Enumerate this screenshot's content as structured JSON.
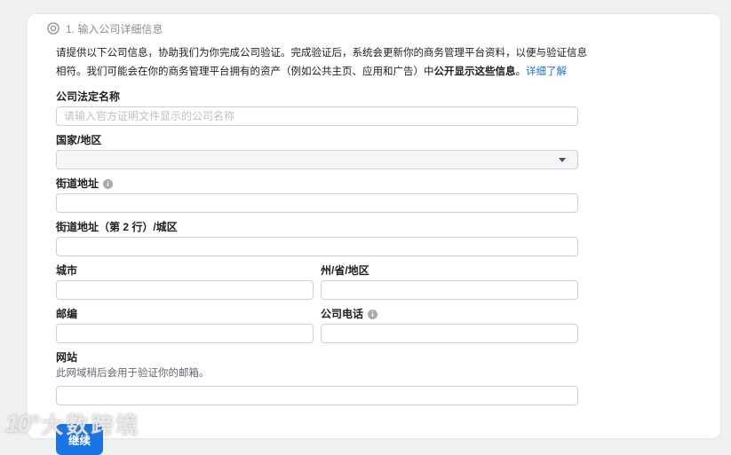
{
  "step": {
    "label": "1. 输入公司详细信息"
  },
  "intro": {
    "text": "请提供以下公司信息，协助我们为你完成公司验证。完成验证后，系统会更新你的商务管理平台资料，以便与验证信息相符。我们可能会在你的商务管理平台拥有的资产（例如公共主页、应用和广告）中",
    "bold": "公开显示这些信息",
    "period": "。",
    "link": "详细了解"
  },
  "fields": {
    "legal_name": {
      "label": "公司法定名称",
      "placeholder": "请输入官方证明文件显示的公司名称",
      "value": ""
    },
    "country": {
      "label": "国家/地区",
      "selected": ""
    },
    "street": {
      "label": "街道地址",
      "value": ""
    },
    "street2": {
      "label": "街道地址（第 2 行）/城区",
      "value": ""
    },
    "city": {
      "label": "城市",
      "value": ""
    },
    "state": {
      "label": "州/省/地区",
      "value": ""
    },
    "postal": {
      "label": "邮编",
      "value": ""
    },
    "phone": {
      "label": "公司电话",
      "value": ""
    },
    "website": {
      "label": "网站",
      "hint": "此网域稍后会用于验证你的邮箱。",
      "value": ""
    }
  },
  "actions": {
    "continue": "继续"
  },
  "watermark": {
    "logo": "10°",
    "text": "大数跨境"
  },
  "colors": {
    "accent": "#1b74e4",
    "link": "#216fdb",
    "page_bg": "#eef0f1"
  }
}
